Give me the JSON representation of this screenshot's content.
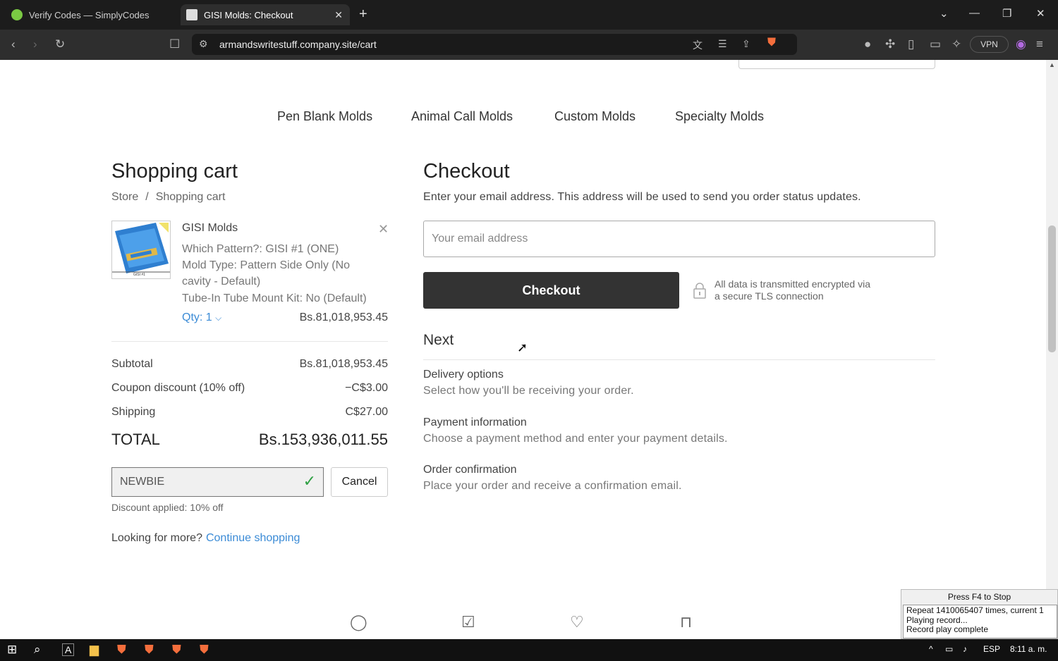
{
  "browser": {
    "tabs": [
      {
        "label": "Verify Codes — SimplyCodes"
      },
      {
        "label": "GISI Molds: Checkout"
      }
    ],
    "url": "armandswritestuff.company.site/cart",
    "vpn_label": "VPN"
  },
  "nav": [
    "Pen Blank Molds",
    "Animal Call Molds",
    "Custom Molds",
    "Specialty Molds"
  ],
  "cart": {
    "title": "Shopping cart",
    "breadcrumb": [
      "Store",
      "Shopping cart"
    ],
    "item": {
      "name": "GISI Molds",
      "options": [
        "Which Pattern?: GISI #1 (ONE)",
        "Mold Type: Pattern Side Only (No",
        "cavity - Default)",
        "Tube-In Tube Mount Kit: No (Default)"
      ],
      "qty_label": "Qty: 1",
      "price": "Bs.81,018,953.45",
      "image_caption": "GISI #1"
    },
    "summary": [
      {
        "label": "Subtotal",
        "value": "Bs.81,018,953.45"
      },
      {
        "label": "Coupon discount (10% off)",
        "value": "−C$3.00"
      },
      {
        "label": "Shipping",
        "value": "C$27.00"
      }
    ],
    "total_label": "TOTAL",
    "total_value": "Bs.153,936,011.55",
    "coupon_code": "NEWBIE",
    "cancel_label": "Cancel",
    "discount_note": "Discount applied: 10% off",
    "more_text": "Looking for more?",
    "continue_link": "Continue shopping"
  },
  "checkout": {
    "title": "Checkout",
    "description": "Enter your email address. This address will be used to send you order status updates.",
    "email_placeholder": "Your email address",
    "button_label": "Checkout",
    "secure_line1": "All data is transmitted encrypted via",
    "secure_line2": "a secure TLS connection",
    "next_heading": "Next",
    "steps": [
      {
        "title": "Delivery options",
        "desc": "Select how you'll be receiving your order."
      },
      {
        "title": "Payment information",
        "desc": "Choose a payment method and enter your payment details."
      },
      {
        "title": "Order confirmation",
        "desc": "Place your order and receive a confirmation email."
      }
    ]
  },
  "recorder": {
    "header": "Press F4 to Stop",
    "lines": [
      "Repeat 1410065407 times, current 1",
      "Playing record...",
      "Record play complete"
    ]
  },
  "taskbar": {
    "lang": "ESP",
    "time": "8:11 a. m."
  }
}
